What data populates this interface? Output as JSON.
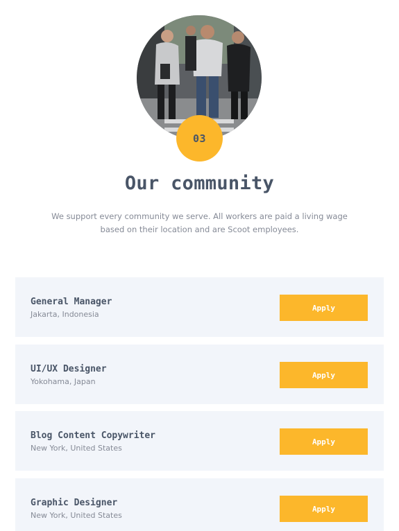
{
  "hero": {
    "badge_number": "03"
  },
  "section": {
    "title": "Our community",
    "description": "We support every community we serve. All workers are paid a living wage based on their location and are Scoot employees."
  },
  "jobs": [
    {
      "title": "General Manager",
      "location": "Jakarta, Indonesia",
      "button": "Apply"
    },
    {
      "title": "UI/UX Designer",
      "location": "Yokohama, Japan",
      "button": "Apply"
    },
    {
      "title": "Blog Content Copywriter",
      "location": "New York, United States",
      "button": "Apply"
    },
    {
      "title": "Graphic Designer",
      "location": "New York, United States",
      "button": "Apply"
    }
  ],
  "colors": {
    "accent": "#fcb72b",
    "heading": "#495567",
    "muted": "#858a96",
    "card_bg": "#f2f5fa"
  }
}
